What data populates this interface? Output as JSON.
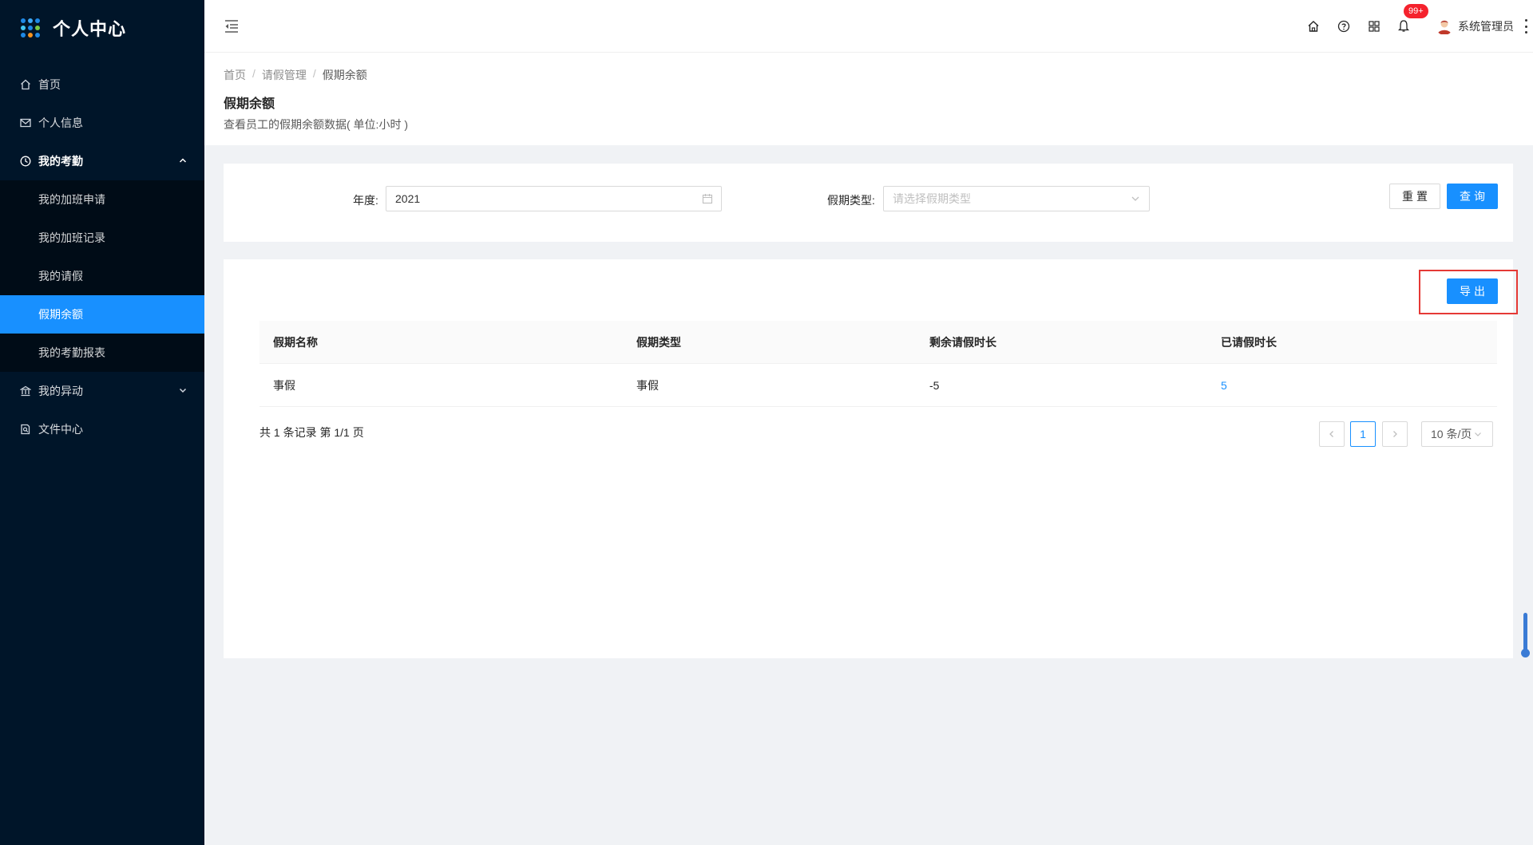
{
  "app": {
    "title": "个人中心"
  },
  "sidebar": {
    "items": [
      {
        "label": "首页",
        "icon": "home-icon"
      },
      {
        "label": "个人信息",
        "icon": "mail-icon"
      },
      {
        "label": "我的考勤",
        "icon": "clock-icon",
        "open": true,
        "children": [
          "我的加班申请",
          "我的加班记录",
          "我的请假",
          "假期余额",
          "我的考勤报表"
        ],
        "active_child": "假期余额"
      },
      {
        "label": "我的异动",
        "icon": "bank-icon"
      },
      {
        "label": "文件中心",
        "icon": "file-search-icon"
      }
    ]
  },
  "header": {
    "notification_badge": "99+",
    "user_name": "系统管理员"
  },
  "breadcrumb": [
    "首页",
    "请假管理",
    "假期余额"
  ],
  "page": {
    "title": "假期余额",
    "description": "查看员工的假期余额数据( 单位:小时 )"
  },
  "filters": {
    "year_label": "年度:",
    "year_value": "2021",
    "type_label": "假期类型:",
    "type_placeholder": "请选择假期类型",
    "reset_label": "重置",
    "query_label": "查询"
  },
  "toolbar": {
    "export_label": "导出"
  },
  "table": {
    "columns": [
      "假期名称",
      "假期类型",
      "剩余请假时长",
      "已请假时长"
    ],
    "rows": [
      [
        "事假",
        "事假",
        "-5",
        "5"
      ]
    ]
  },
  "pagination": {
    "summary": "共 1 条记录 第 1/1 页",
    "current_page": "1",
    "page_size": "10 条/页"
  },
  "colors": {
    "primary": "#1890ff",
    "sidebar_bg": "#001529",
    "highlight_border": "#e53935"
  }
}
